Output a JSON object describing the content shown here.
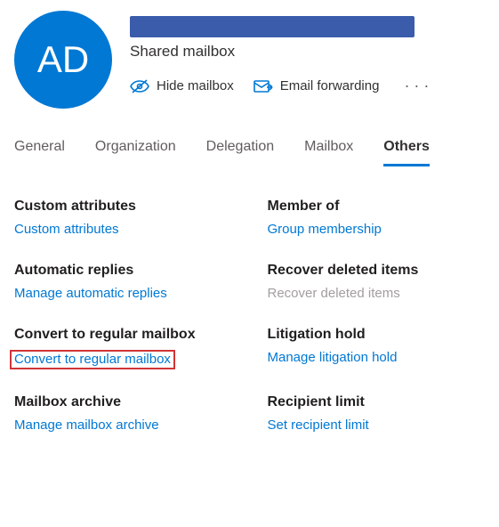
{
  "avatar": {
    "initials": "AD"
  },
  "subtitle": "Shared mailbox",
  "actions": {
    "hide": "Hide mailbox",
    "forward": "Email forwarding"
  },
  "tabs": {
    "general": "General",
    "organization": "Organization",
    "delegation": "Delegation",
    "mailbox": "Mailbox",
    "others": "Others",
    "active": "others"
  },
  "sections": {
    "customAttributes": {
      "title": "Custom attributes",
      "link": "Custom attributes"
    },
    "memberOf": {
      "title": "Member of",
      "link": "Group membership"
    },
    "autoReplies": {
      "title": "Automatic replies",
      "link": "Manage automatic replies"
    },
    "recoverDeleted": {
      "title": "Recover deleted items",
      "link": "Recover deleted items"
    },
    "convertRegular": {
      "title": "Convert to regular mailbox",
      "link": "Convert to regular mailbox"
    },
    "litigationHold": {
      "title": "Litigation hold",
      "link": "Manage litigation hold"
    },
    "mailboxArchive": {
      "title": "Mailbox archive",
      "link": "Manage mailbox archive"
    },
    "recipientLimit": {
      "title": "Recipient limit",
      "link": "Set recipient limit"
    }
  }
}
